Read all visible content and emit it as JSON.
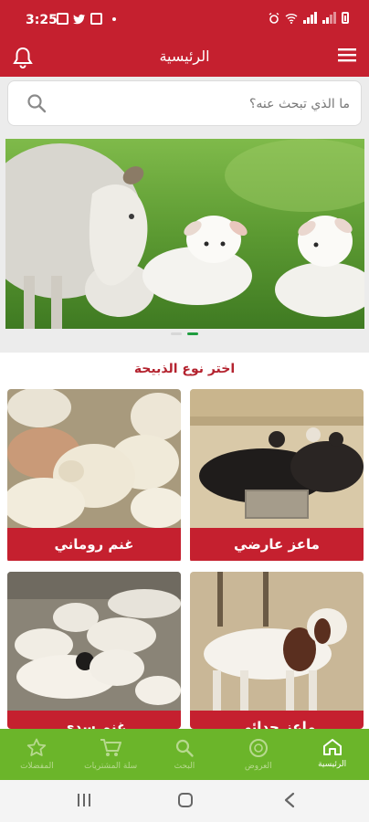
{
  "status_bar": {
    "time": "3:25"
  },
  "app_bar": {
    "title": "الرئيسية"
  },
  "search": {
    "placeholder": "ما الذي تبحث عنه؟"
  },
  "banner": {
    "slides": 2,
    "active_slide": 1
  },
  "categories": {
    "title": "اختر نوع الذبيحة",
    "items": [
      {
        "label": "ماعز عارضي"
      },
      {
        "label": "غنم روماني"
      },
      {
        "label": "ماعز حدائي"
      },
      {
        "label": "غنم سدي"
      }
    ]
  },
  "bottom_nav": {
    "items": [
      {
        "label": "الرئيسية",
        "icon": "home-icon",
        "active": true
      },
      {
        "label": "العروض",
        "icon": "offers-icon",
        "active": false
      },
      {
        "label": "البحث",
        "icon": "search-icon",
        "active": false
      },
      {
        "label": "سلة المشتريات",
        "icon": "cart-icon",
        "active": false
      },
      {
        "label": "المفضلات",
        "icon": "star-icon",
        "active": false
      }
    ]
  },
  "colors": {
    "primary": "#c5202f",
    "nav": "#6bb52a",
    "accent": "#1f9d3f"
  }
}
